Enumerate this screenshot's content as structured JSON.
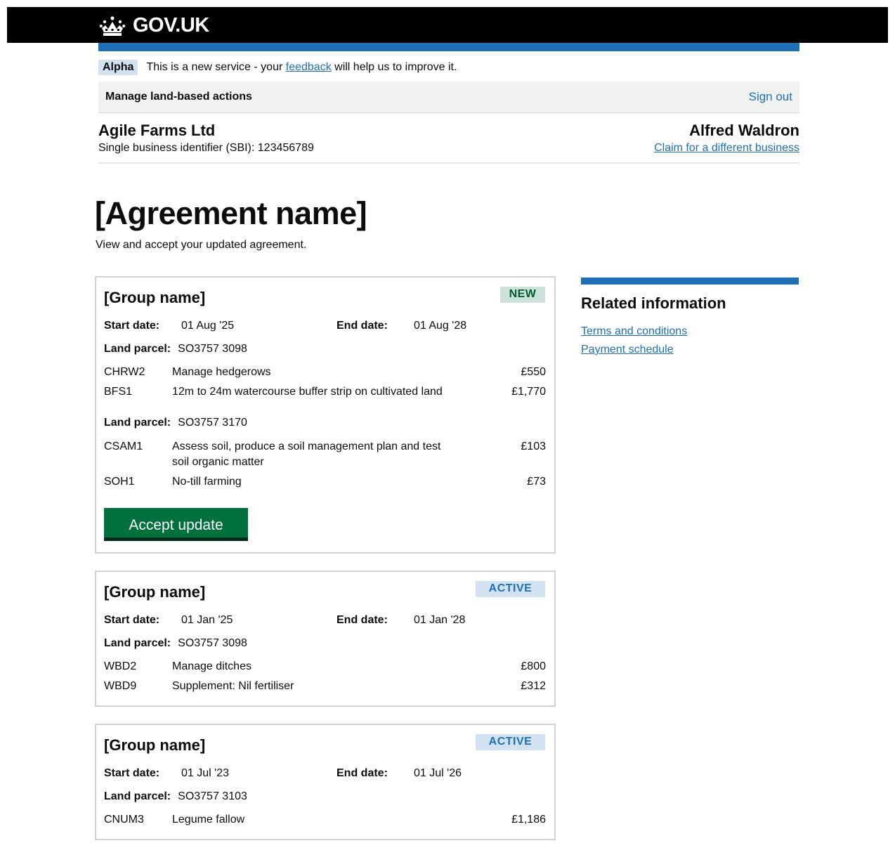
{
  "header": {
    "logo_text": "GOV.UK",
    "logo_icon": "crown-icon"
  },
  "phase_banner": {
    "tag": "Alpha",
    "text_before": "This is a new service - your",
    "link": "feedback",
    "text_after": "will help us to improve it."
  },
  "service_nav": {
    "service_name": "Manage land-based actions",
    "sign_out": "Sign out"
  },
  "business": {
    "name": "Agile Farms Ltd",
    "sbi": "Single business identifier (SBI): 123456789",
    "user": "Alfred Waldron",
    "switch_link": "Claim for a different business"
  },
  "page": {
    "title": "[Agreement name]",
    "lede": "View and accept your updated agreement."
  },
  "labels": {
    "start_date": "Start date:",
    "end_date": "End date:",
    "land_parcel": "Land parcel:"
  },
  "cards": [
    {
      "title": "[Group name]",
      "status": "NEW",
      "start": "01 Aug '25",
      "end": "01 Aug '28",
      "parcels": [
        {
          "id": "SO3757 3098",
          "actions": [
            {
              "code": "CHRW2",
              "desc": "Manage hedgerows",
              "amount": "£550"
            },
            {
              "code": "BFS1",
              "desc": "12m to 24m watercourse buffer strip on cultivated land",
              "amount": "£1,770"
            }
          ]
        },
        {
          "id": "SO3757 3170",
          "actions": [
            {
              "code": "CSAM1",
              "desc": "Assess soil, produce a soil management plan and test soil organic matter",
              "amount": "£103"
            },
            {
              "code": "SOH1",
              "desc": "No-till farming",
              "amount": "£73"
            }
          ]
        }
      ],
      "button": "Accept update"
    },
    {
      "title": "[Group name]",
      "status": "ACTIVE",
      "start": "01 Jan '25",
      "end": "01 Jan '28",
      "parcels": [
        {
          "id": "SO3757 3098",
          "actions": [
            {
              "code": "WBD2",
              "desc": "Manage ditches",
              "amount": "£800"
            },
            {
              "code": "WBD9",
              "desc": "Supplement: Nil fertiliser",
              "amount": "£312"
            }
          ]
        }
      ]
    },
    {
      "title": "[Group name]",
      "status": "ACTIVE",
      "start": "01 Jul '23",
      "end": "01 Jul '26",
      "parcels": [
        {
          "id": "SO3757 3103",
          "actions": [
            {
              "code": "CNUM3",
              "desc": "Legume fallow",
              "amount": "£1,186"
            }
          ]
        }
      ]
    }
  ],
  "related": {
    "heading": "Related information",
    "links": [
      "Terms and conditions",
      "Payment schedule"
    ]
  },
  "colors": {
    "brand_blue": "#1d70b8",
    "button_green": "#00703c",
    "new_tag_bg": "#cce2d8",
    "active_tag_bg": "#d2e2f1"
  }
}
